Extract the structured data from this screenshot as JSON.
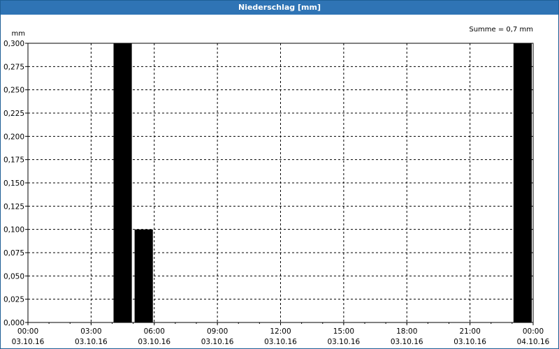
{
  "window": {
    "title": "Niederschlag [mm]"
  },
  "chart_data": {
    "type": "bar",
    "title": "Niederschlag [mm]",
    "ylabel_unit": "mm",
    "summary": "Summe = 0,7 mm",
    "ylim": [
      0,
      0.3
    ],
    "grid": true,
    "y_ticks": [
      "0,000",
      "0,025",
      "0,050",
      "0,075",
      "0,100",
      "0,125",
      "0,150",
      "0,175",
      "0,200",
      "0,225",
      "0,250",
      "0,275",
      "0,300"
    ],
    "x_ticks": [
      {
        "time": "00:00",
        "date": "03.10.16"
      },
      {
        "time": "03:00",
        "date": "03.10.16"
      },
      {
        "time": "06:00",
        "date": "03.10.16"
      },
      {
        "time": "09:00",
        "date": "03.10.16"
      },
      {
        "time": "12:00",
        "date": "03.10.16"
      },
      {
        "time": "15:00",
        "date": "03.10.16"
      },
      {
        "time": "18:00",
        "date": "03.10.16"
      },
      {
        "time": "21:00",
        "date": "03.10.16"
      },
      {
        "time": "00:00",
        "date": "04.10.16"
      }
    ],
    "x_range_hours": [
      0,
      24
    ],
    "bar_color": "#000000",
    "bars": [
      {
        "start": "04:00",
        "end": "05:00",
        "value": 0.3
      },
      {
        "start": "05:00",
        "end": "06:00",
        "value": 0.1
      },
      {
        "start": "23:00",
        "end": "24:00",
        "value": 0.3
      }
    ]
  }
}
